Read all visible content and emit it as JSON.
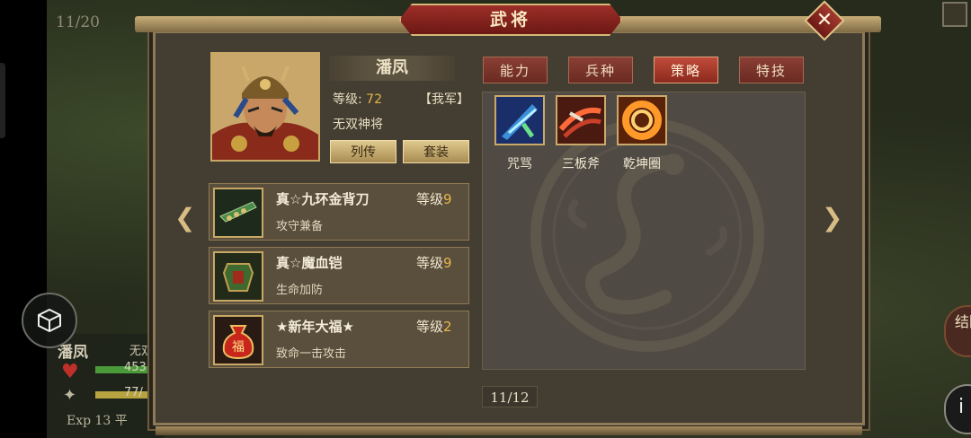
{
  "scene": {
    "page_counter": "11/20",
    "hero_name": "潘凤",
    "hero_desc": "无双",
    "hp_value": "453",
    "mp_value": "77/",
    "exp_text": "Exp 13 平",
    "side_button_text": "结回",
    "info_button_text": "i"
  },
  "window": {
    "title": "武将",
    "close_icon": "close-x-icon"
  },
  "general": {
    "name": "潘凤",
    "level_label": "等级:",
    "level_value": "72",
    "faction": "【我军】",
    "title": "无双神将",
    "btn_biography": "列传",
    "btn_set": "套装"
  },
  "tabs": [
    {
      "label": "能力",
      "active": false
    },
    {
      "label": "兵种",
      "active": false
    },
    {
      "label": "策略",
      "active": true
    },
    {
      "label": "特技",
      "active": false
    }
  ],
  "equipment": [
    {
      "name": "真☆九环金背刀",
      "level_label": "等级",
      "level": "9",
      "desc": "攻守兼备",
      "icon": "blade-icon"
    },
    {
      "name": "真☆魔血铠",
      "level_label": "等级",
      "level": "9",
      "desc": "生命加防",
      "icon": "armor-icon"
    },
    {
      "name": "★新年大福★",
      "level_label": "等级",
      "level": "2",
      "desc": "致命一击攻击",
      "icon": "lucky-bag-icon"
    }
  ],
  "bag_char": "福",
  "skills": [
    {
      "name": "咒骂",
      "icon": "curse-icon",
      "color": "#3a8fd8"
    },
    {
      "name": "三板斧",
      "icon": "triple-axe-icon",
      "color": "#c8402a"
    },
    {
      "name": "乾坤圈",
      "icon": "qiankun-ring-icon",
      "color": "#e06a1c"
    }
  ],
  "pager": "11/12",
  "colors": {
    "accent_red": "#9d2e28",
    "gold": "#e5b64a",
    "panel": "#443d31"
  }
}
